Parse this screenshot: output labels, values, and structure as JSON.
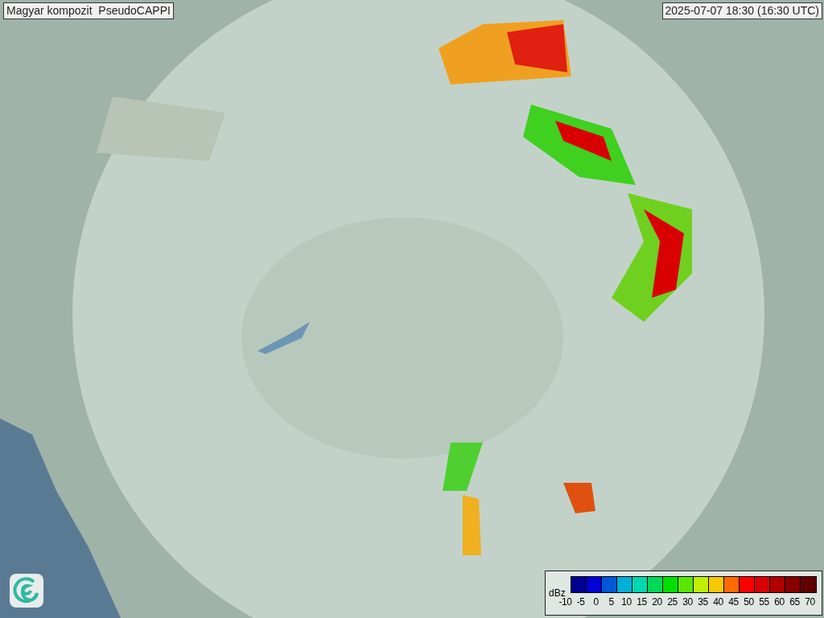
{
  "title": "Magyar kompozit  PseudoCAPPI",
  "timestamp": "2025-07-07 18:30 (16:30 UTC)",
  "legend": {
    "unit": "dBz",
    "bins": [
      {
        "color": "#000090"
      },
      {
        "color": "#0000d8"
      },
      {
        "color": "#0058d8"
      },
      {
        "color": "#00b0d8"
      },
      {
        "color": "#00d8b0"
      },
      {
        "color": "#00d858"
      },
      {
        "color": "#00e000"
      },
      {
        "color": "#58e800"
      },
      {
        "color": "#c0f000"
      },
      {
        "color": "#f8c800"
      },
      {
        "color": "#ff6800"
      },
      {
        "color": "#ff0000"
      },
      {
        "color": "#d80000"
      },
      {
        "color": "#b00000"
      },
      {
        "color": "#880000"
      },
      {
        "color": "#600000"
      }
    ],
    "ticks": [
      "-10",
      "-5",
      "0",
      "5",
      "10",
      "15",
      "20",
      "25",
      "30",
      "35",
      "40",
      "45",
      "50",
      "55",
      "60",
      "65",
      "70"
    ]
  }
}
